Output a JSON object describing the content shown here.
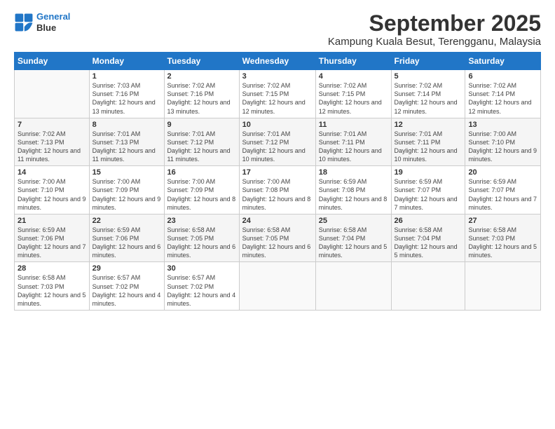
{
  "header": {
    "title": "September 2025",
    "subtitle": "Kampung Kuala Besut, Terengganu, Malaysia"
  },
  "columns": [
    "Sunday",
    "Monday",
    "Tuesday",
    "Wednesday",
    "Thursday",
    "Friday",
    "Saturday"
  ],
  "weeks": [
    [
      {
        "day": "",
        "info": ""
      },
      {
        "day": "1",
        "info": "Sunrise: 7:03 AM\nSunset: 7:16 PM\nDaylight: 12 hours\nand 13 minutes."
      },
      {
        "day": "2",
        "info": "Sunrise: 7:02 AM\nSunset: 7:16 PM\nDaylight: 12 hours\nand 13 minutes."
      },
      {
        "day": "3",
        "info": "Sunrise: 7:02 AM\nSunset: 7:15 PM\nDaylight: 12 hours\nand 12 minutes."
      },
      {
        "day": "4",
        "info": "Sunrise: 7:02 AM\nSunset: 7:15 PM\nDaylight: 12 hours\nand 12 minutes."
      },
      {
        "day": "5",
        "info": "Sunrise: 7:02 AM\nSunset: 7:14 PM\nDaylight: 12 hours\nand 12 minutes."
      },
      {
        "day": "6",
        "info": "Sunrise: 7:02 AM\nSunset: 7:14 PM\nDaylight: 12 hours\nand 12 minutes."
      }
    ],
    [
      {
        "day": "7",
        "info": "Sunrise: 7:02 AM\nSunset: 7:13 PM\nDaylight: 12 hours\nand 11 minutes."
      },
      {
        "day": "8",
        "info": "Sunrise: 7:01 AM\nSunset: 7:13 PM\nDaylight: 12 hours\nand 11 minutes."
      },
      {
        "day": "9",
        "info": "Sunrise: 7:01 AM\nSunset: 7:12 PM\nDaylight: 12 hours\nand 11 minutes."
      },
      {
        "day": "10",
        "info": "Sunrise: 7:01 AM\nSunset: 7:12 PM\nDaylight: 12 hours\nand 10 minutes."
      },
      {
        "day": "11",
        "info": "Sunrise: 7:01 AM\nSunset: 7:11 PM\nDaylight: 12 hours\nand 10 minutes."
      },
      {
        "day": "12",
        "info": "Sunrise: 7:01 AM\nSunset: 7:11 PM\nDaylight: 12 hours\nand 10 minutes."
      },
      {
        "day": "13",
        "info": "Sunrise: 7:00 AM\nSunset: 7:10 PM\nDaylight: 12 hours\nand 9 minutes."
      }
    ],
    [
      {
        "day": "14",
        "info": "Sunrise: 7:00 AM\nSunset: 7:10 PM\nDaylight: 12 hours\nand 9 minutes."
      },
      {
        "day": "15",
        "info": "Sunrise: 7:00 AM\nSunset: 7:09 PM\nDaylight: 12 hours\nand 9 minutes."
      },
      {
        "day": "16",
        "info": "Sunrise: 7:00 AM\nSunset: 7:09 PM\nDaylight: 12 hours\nand 8 minutes."
      },
      {
        "day": "17",
        "info": "Sunrise: 7:00 AM\nSunset: 7:08 PM\nDaylight: 12 hours\nand 8 minutes."
      },
      {
        "day": "18",
        "info": "Sunrise: 6:59 AM\nSunset: 7:08 PM\nDaylight: 12 hours\nand 8 minutes."
      },
      {
        "day": "19",
        "info": "Sunrise: 6:59 AM\nSunset: 7:07 PM\nDaylight: 12 hours\nand 7 minutes."
      },
      {
        "day": "20",
        "info": "Sunrise: 6:59 AM\nSunset: 7:07 PM\nDaylight: 12 hours\nand 7 minutes."
      }
    ],
    [
      {
        "day": "21",
        "info": "Sunrise: 6:59 AM\nSunset: 7:06 PM\nDaylight: 12 hours\nand 7 minutes."
      },
      {
        "day": "22",
        "info": "Sunrise: 6:59 AM\nSunset: 7:06 PM\nDaylight: 12 hours\nand 6 minutes."
      },
      {
        "day": "23",
        "info": "Sunrise: 6:58 AM\nSunset: 7:05 PM\nDaylight: 12 hours\nand 6 minutes."
      },
      {
        "day": "24",
        "info": "Sunrise: 6:58 AM\nSunset: 7:05 PM\nDaylight: 12 hours\nand 6 minutes."
      },
      {
        "day": "25",
        "info": "Sunrise: 6:58 AM\nSunset: 7:04 PM\nDaylight: 12 hours\nand 5 minutes."
      },
      {
        "day": "26",
        "info": "Sunrise: 6:58 AM\nSunset: 7:04 PM\nDaylight: 12 hours\nand 5 minutes."
      },
      {
        "day": "27",
        "info": "Sunrise: 6:58 AM\nSunset: 7:03 PM\nDaylight: 12 hours\nand 5 minutes."
      }
    ],
    [
      {
        "day": "28",
        "info": "Sunrise: 6:58 AM\nSunset: 7:03 PM\nDaylight: 12 hours\nand 5 minutes."
      },
      {
        "day": "29",
        "info": "Sunrise: 6:57 AM\nSunset: 7:02 PM\nDaylight: 12 hours\nand 4 minutes."
      },
      {
        "day": "30",
        "info": "Sunrise: 6:57 AM\nSunset: 7:02 PM\nDaylight: 12 hours\nand 4 minutes."
      },
      {
        "day": "",
        "info": ""
      },
      {
        "day": "",
        "info": ""
      },
      {
        "day": "",
        "info": ""
      },
      {
        "day": "",
        "info": ""
      }
    ]
  ]
}
